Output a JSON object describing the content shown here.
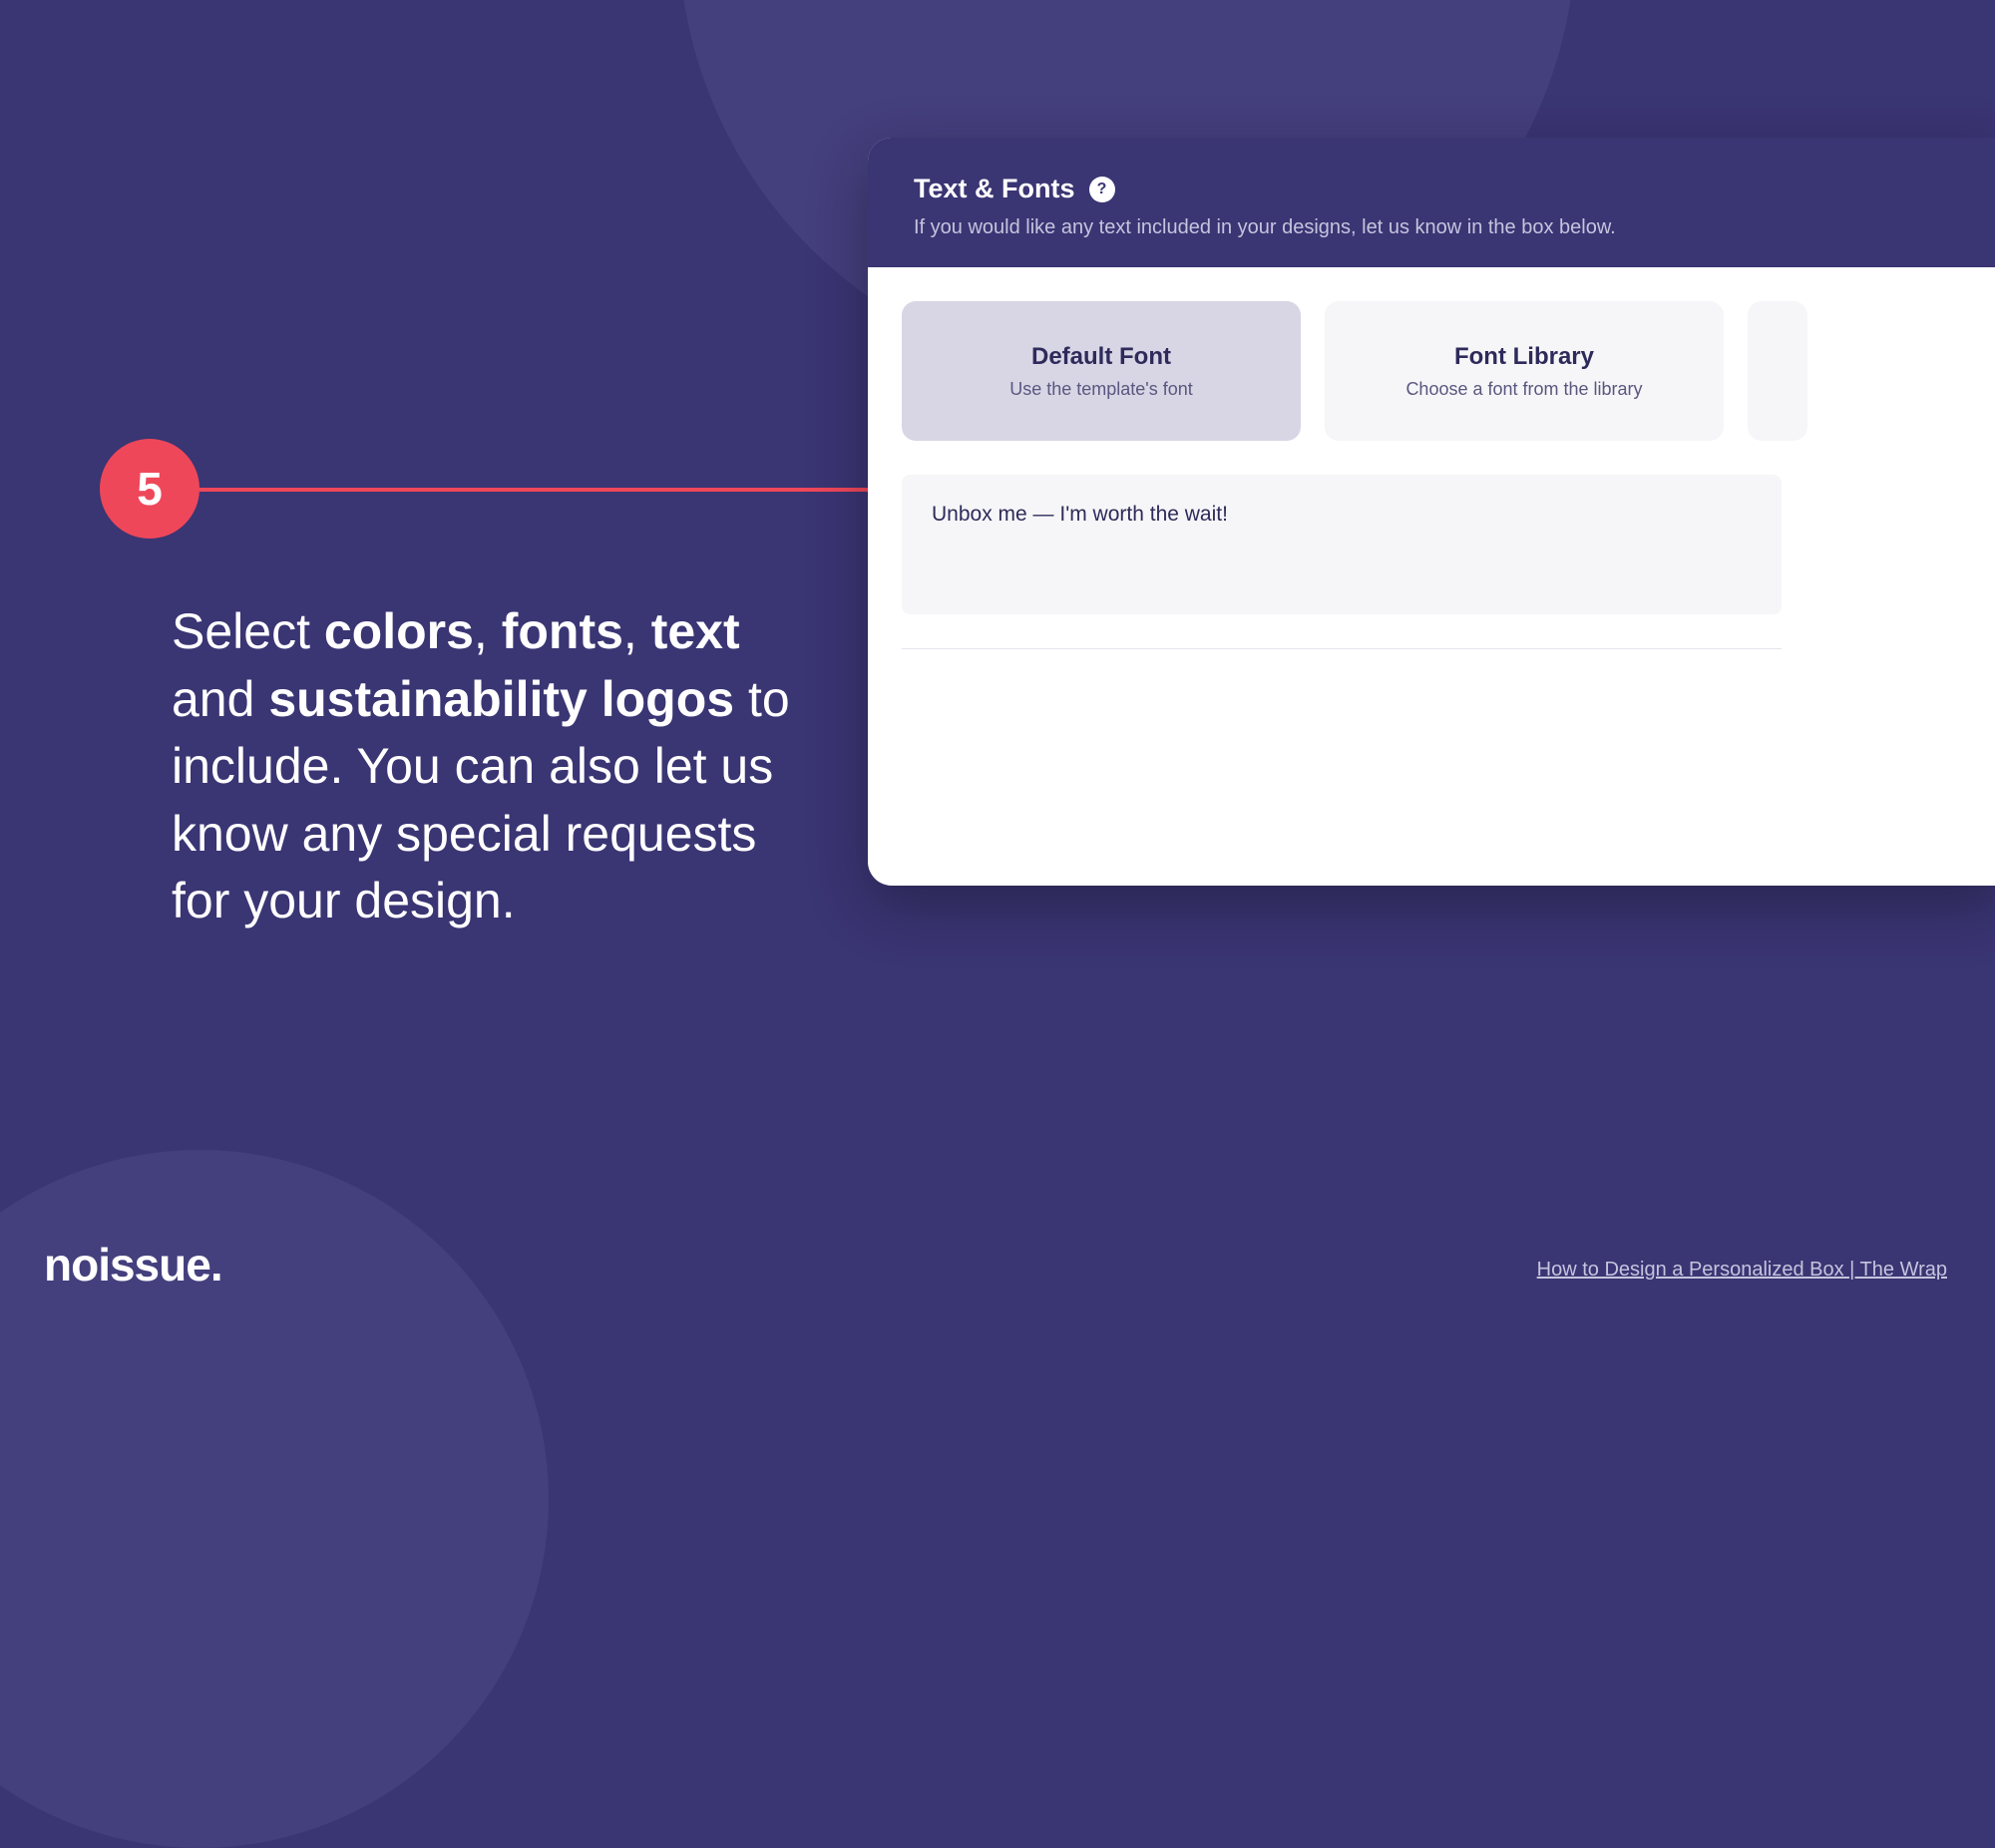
{
  "step": {
    "number": "5",
    "instruction_parts": {
      "p1": "Select ",
      "b1": "colors",
      "p2": ", ",
      "b2": "fonts",
      "p3": ", ",
      "b3": "text",
      "p4": " and ",
      "b4": "sustainability logos",
      "p5": " to include. You can also let us know any special requests for your design."
    }
  },
  "panel": {
    "title": "Text & Fonts",
    "help_glyph": "?",
    "subtitle": "If you would like any text included in your designs, let us know in the box below.",
    "font_options": [
      {
        "title": "Default Font",
        "subtitle": "Use the template's font",
        "selected": true
      },
      {
        "title": "Font Library",
        "subtitle": "Choose a font from the library",
        "selected": false
      }
    ],
    "text_input_value": "Unbox me — I'm worth the wait!"
  },
  "brand": "noissue.",
  "footer_link": "How to Design a Personalized Box | The Wrap"
}
